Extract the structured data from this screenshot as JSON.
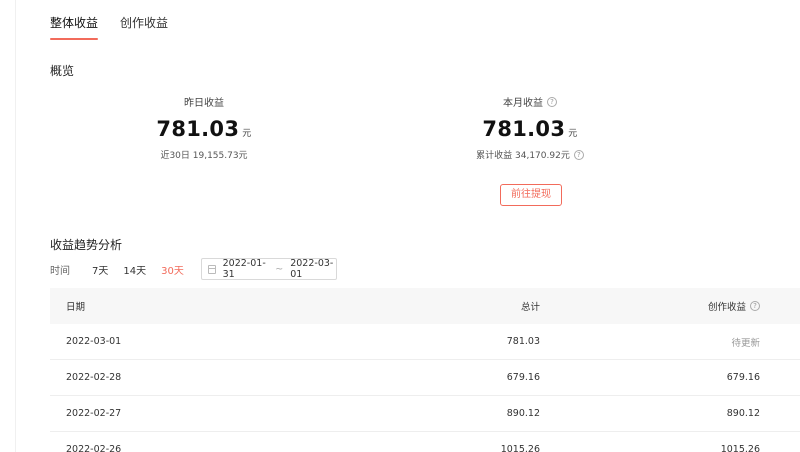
{
  "tabs": [
    {
      "label": "整体收益",
      "active": true
    },
    {
      "label": "创作收益",
      "active": false
    }
  ],
  "overview": {
    "title": "概览",
    "yesterday": {
      "label": "昨日收益",
      "value": "781.03",
      "unit": "元",
      "sub": "近30日 19,155.73元"
    },
    "month": {
      "label": "本月收益",
      "value": "781.03",
      "unit": "元",
      "sub": "累计收益 34,170.92元"
    },
    "withdraw_label": "前往提现"
  },
  "trend": {
    "title": "收益趋势分析",
    "time_label": "时间",
    "ranges": [
      {
        "label": "7天",
        "active": false
      },
      {
        "label": "14天",
        "active": false
      },
      {
        "label": "30天",
        "active": true
      }
    ],
    "date_start": "2022-01-31",
    "date_sep": "~",
    "date_end": "2022-03-01"
  },
  "table": {
    "headers": [
      "日期",
      "总计",
      "创作收益"
    ],
    "rows": [
      [
        "2022-03-01",
        "781.03",
        "待更新"
      ],
      [
        "2022-02-28",
        "679.16",
        "679.16"
      ],
      [
        "2022-02-27",
        "890.12",
        "890.12"
      ],
      [
        "2022-02-26",
        "1015.26",
        "1015.26"
      ]
    ]
  },
  "colors": {
    "accent": "#f26b5b",
    "header_bg": "#f7f7f7"
  }
}
